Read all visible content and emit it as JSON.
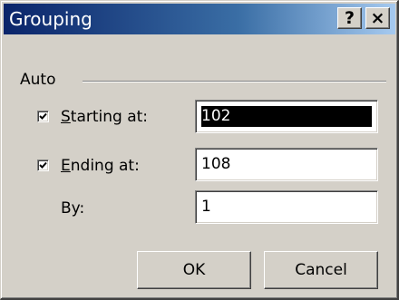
{
  "window": {
    "title": "Grouping",
    "help_label": "?",
    "close_label": "×",
    "title_gradient": [
      "#0a246a",
      "#a6caf0"
    ],
    "face_color": "#d4d0c8"
  },
  "auto_group": {
    "label": "Auto",
    "starting": {
      "accel": "S",
      "label_rest": "tarting at:",
      "checked": true,
      "value": "102",
      "selected": true
    },
    "ending": {
      "accel": "E",
      "label_rest": "nding at:",
      "checked": true,
      "value": "108"
    }
  },
  "by": {
    "label": "By:",
    "value": "1"
  },
  "buttons": {
    "ok": "OK",
    "cancel": "Cancel"
  }
}
